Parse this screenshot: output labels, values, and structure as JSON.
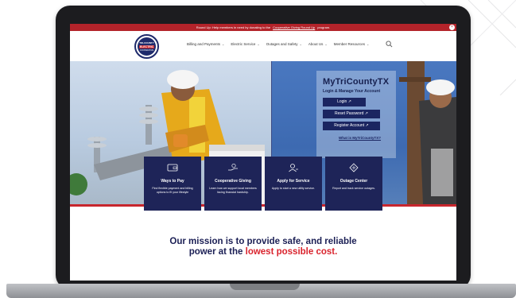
{
  "announcement": {
    "text": "Round Up: Help members in need by donating to the",
    "link": "Cooperative Giving Round Up",
    "suffix": "program."
  },
  "logo": {
    "top": "TRI-COUNTY",
    "mid": "ELECTRIC",
    "bot": "COOPERATIVE"
  },
  "nav": {
    "items": [
      {
        "label": "Billing and Payments"
      },
      {
        "label": "Electric Service"
      },
      {
        "label": "Outages and Safety"
      },
      {
        "label": "About Us"
      },
      {
        "label": "Member Resources"
      }
    ]
  },
  "login": {
    "title": "MyTriCountyTX",
    "subtitle": "Login & Manage Your Account",
    "buttons": [
      {
        "label": "Login"
      },
      {
        "label": "Reset Password"
      },
      {
        "label": "Register Account"
      }
    ],
    "link": "What is MyTriCountyTX?"
  },
  "cards": [
    {
      "title": "Ways to Pay",
      "desc": "Find flexible payment and billing options to fit your lifestyle",
      "icon": "wallet-icon"
    },
    {
      "title": "Cooperative Giving",
      "desc": "Learn how we support local members facing financial hardship.",
      "icon": "giving-hand-icon"
    },
    {
      "title": "Apply for Service",
      "desc": "Apply to start a new utility service.",
      "icon": "user-apply-icon"
    },
    {
      "title": "Outage Center",
      "desc": "Report and track service outages.",
      "icon": "outage-icon"
    }
  ],
  "mission": {
    "line1": "Our mission is to provide safe, and reliable",
    "line2_prefix": "power at the ",
    "line2_highlight": "lowest possible cost."
  },
  "colors": {
    "navy": "#1e2458",
    "red": "#c8262d",
    "announce": "#b3232a"
  }
}
